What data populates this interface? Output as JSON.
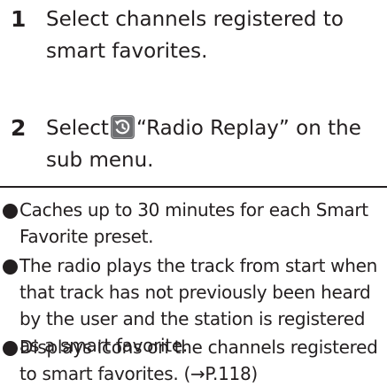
{
  "steps": [
    {
      "number": "1",
      "text": "Select channels registered to smart favorites."
    },
    {
      "number": "2",
      "text_before": "Select",
      "icon": "radio-replay-icon",
      "text_after": "“Radio Replay” on the sub menu."
    }
  ],
  "notes": [
    "Caches up to 30 minutes for each Smart Favorite preset.",
    "The radio plays the track from start when that track has not previously been heard by the user and the station is registered as a smart favorite.",
    "Displays icons on the channels registered to smart favorites. (→P.118)"
  ],
  "colors": {
    "text": "#231f20",
    "icon_bg": "#6d6e71"
  }
}
